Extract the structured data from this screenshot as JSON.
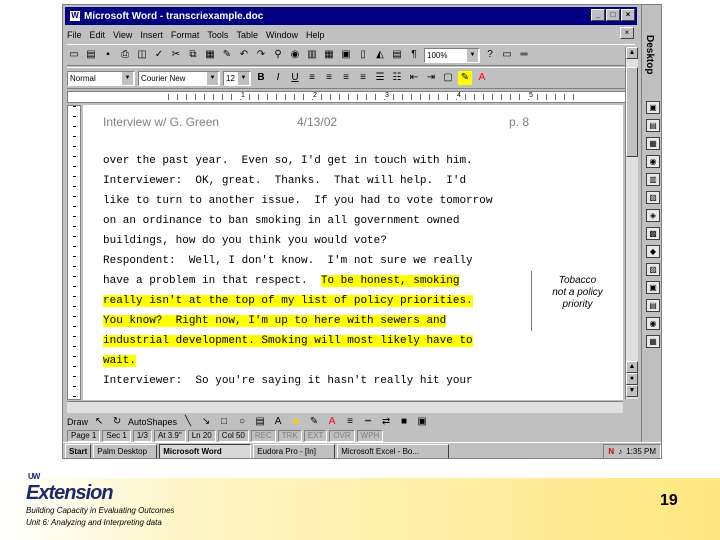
{
  "window": {
    "title": "Microsoft Word - transcriexample.doc",
    "controls": [
      "_",
      "□",
      "×"
    ]
  },
  "menu": [
    "File",
    "Edit",
    "View",
    "Insert",
    "Format",
    "Tools",
    "Table",
    "Window",
    "Help"
  ],
  "toolbar": {
    "zoom": "100%",
    "style": "Normal",
    "font": "Courier New",
    "size": "12",
    "bold": "B",
    "italic": "I",
    "underline": "U"
  },
  "ruler": {
    "marks": [
      "1",
      "2",
      "3",
      "4",
      "5"
    ]
  },
  "document": {
    "header": {
      "left": "Interview w/ G. Green",
      "center": "4/13/02",
      "right": "p. 8"
    },
    "lines": [
      {
        "text": "over the past year.  Even so, I'd get in touch with him.",
        "hl": ""
      },
      {
        "text": "Interviewer:  OK, great.  Thanks.  That will help.  I'd",
        "hl": ""
      },
      {
        "text": "like to turn to another issue.  If you had to vote tomorrow",
        "hl": ""
      },
      {
        "text": "on an ordinance to ban smoking in all government owned",
        "hl": ""
      },
      {
        "text": "buildings, how do you think you would vote?",
        "hl": ""
      },
      {
        "text": "Respondent:  Well, I don't know.  I'm not sure we really",
        "hl": ""
      },
      {
        "text": "have a problem in that respect.  ",
        "hl": "To be honest, smoking"
      },
      {
        "text": "",
        "hl": "really isn't at the top of my list of policy priorities."
      },
      {
        "text": "",
        "hl": "You know?  Right now, I'm up to here with sewers and"
      },
      {
        "text": "",
        "hl": "industrial development. Smoking will most likely have to"
      },
      {
        "text": "",
        "hl": "wait."
      },
      {
        "text": "Interviewer:  So you're saying it hasn't really hit your",
        "hl": ""
      }
    ],
    "comment": [
      "Tobacco",
      "not a policy",
      "priority"
    ]
  },
  "drawing": {
    "draw": "Draw",
    "autoshapes": "AutoShapes"
  },
  "status": {
    "page": "Page 1",
    "sec": "Sec 1",
    "pages": "1/3",
    "at": "At 3.9\"",
    "ln": "Ln 20",
    "col": "Col 50",
    "rec": "REC",
    "trk": "TRK",
    "ext": "EXT",
    "ovr": "OVR",
    "wph": "WPH"
  },
  "taskbar": {
    "start": "Start",
    "tasks": [
      "Palm Desktop",
      "Microsoft Word",
      "Eudora Pro - [In]",
      "Microsoft Excel - Bo..."
    ],
    "time": "1:35 PM"
  },
  "desktop_label": "Desktop",
  "footer": {
    "logo_small": "UW",
    "logo": "Extension",
    "line1": "Building Capacity in Evaluating Outcomes",
    "line2": "Unit 6: Analyzing and Interpreting data",
    "page_number": "19"
  }
}
